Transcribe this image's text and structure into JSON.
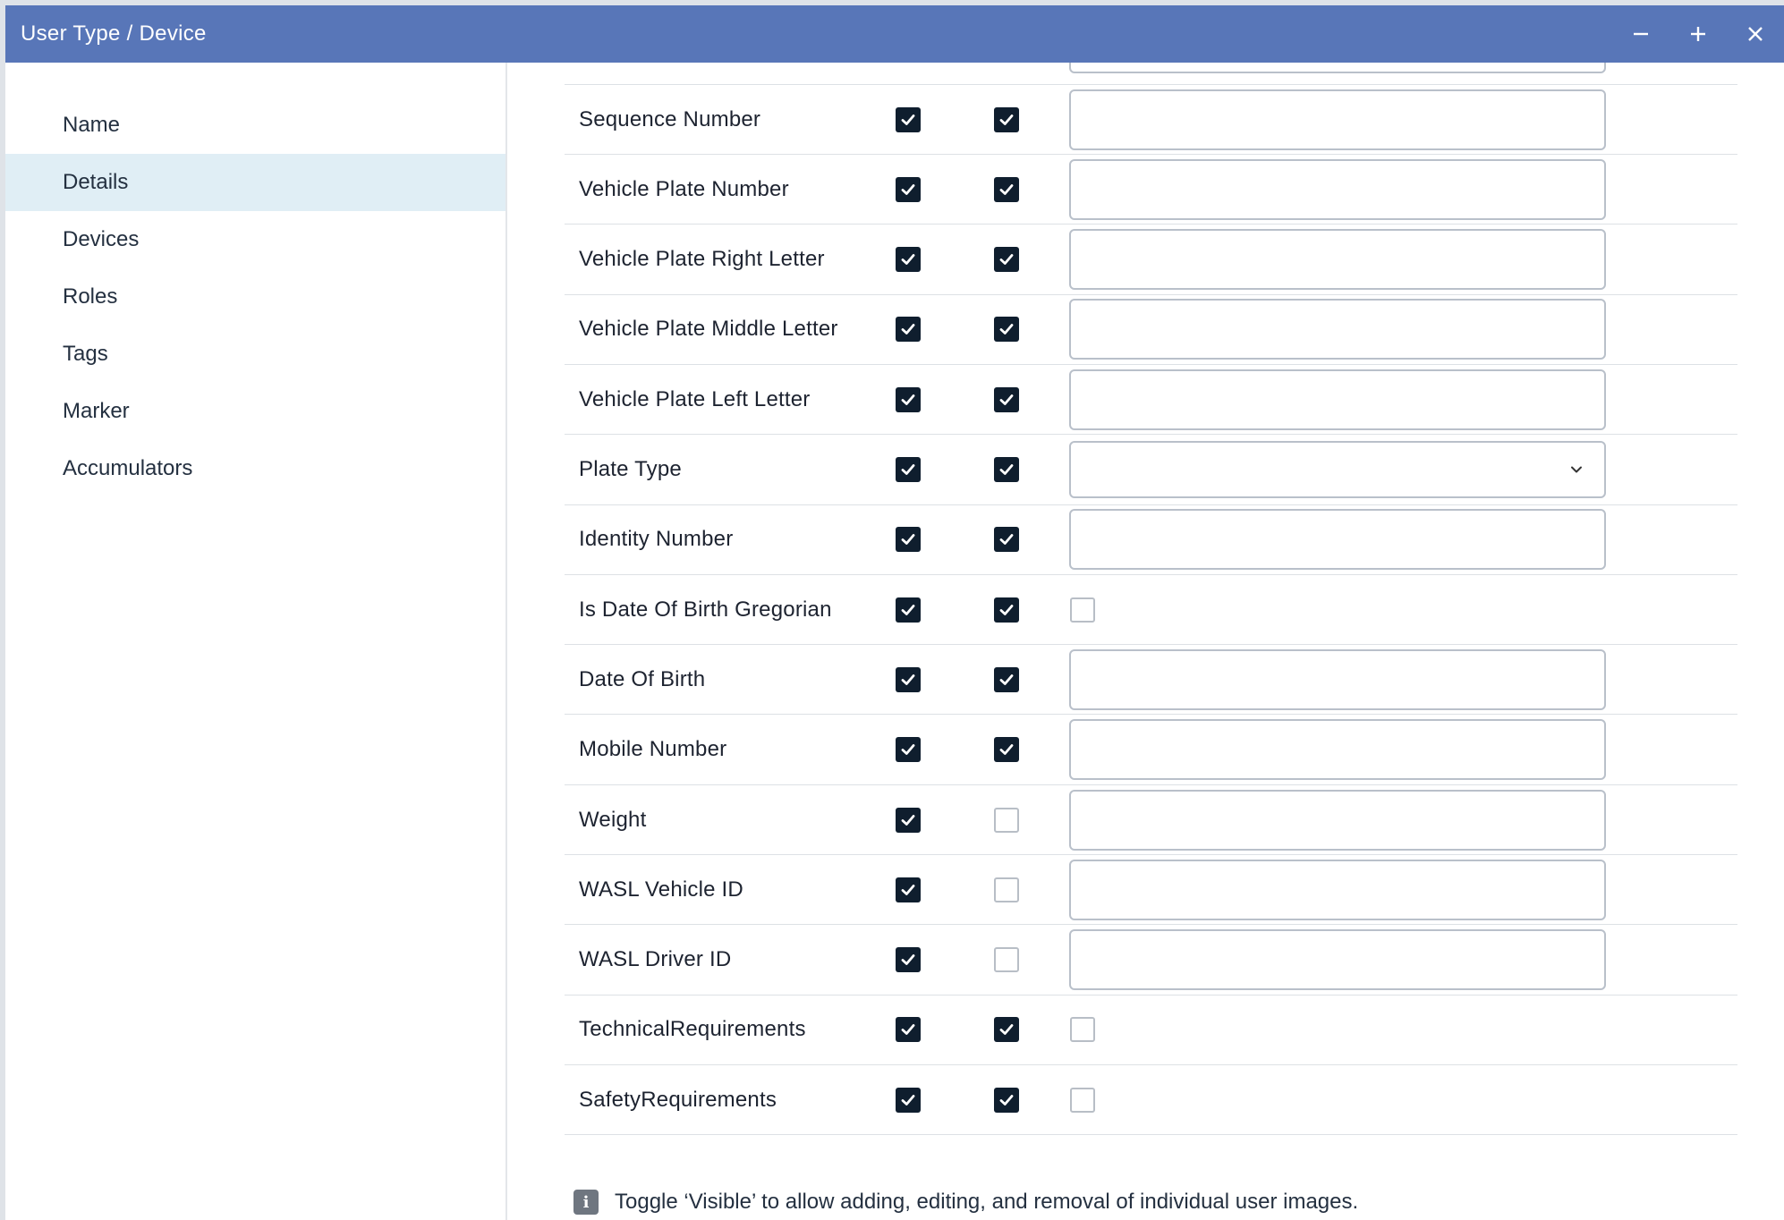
{
  "window": {
    "title": "User Type / Device",
    "minimize_icon": "minus-icon",
    "maximize_icon": "plus-icon",
    "close_icon": "close-icon"
  },
  "sidebar": {
    "items": [
      {
        "label": "Name",
        "active": false
      },
      {
        "label": "Details",
        "active": true
      },
      {
        "label": "Devices",
        "active": false
      },
      {
        "label": "Roles",
        "active": false
      },
      {
        "label": "Tags",
        "active": false
      },
      {
        "label": "Marker",
        "active": false
      },
      {
        "label": "Accumulators",
        "active": false
      }
    ]
  },
  "fields": [
    {
      "label": "Sequence Number",
      "col1": true,
      "col2": true,
      "control": "text",
      "value": ""
    },
    {
      "label": "Vehicle Plate Number",
      "col1": true,
      "col2": true,
      "control": "text",
      "value": ""
    },
    {
      "label": "Vehicle Plate Right Letter",
      "col1": true,
      "col2": true,
      "control": "text",
      "value": ""
    },
    {
      "label": "Vehicle Plate Middle Letter",
      "col1": true,
      "col2": true,
      "control": "text",
      "value": ""
    },
    {
      "label": "Vehicle Plate Left Letter",
      "col1": true,
      "col2": true,
      "control": "text",
      "value": ""
    },
    {
      "label": "Plate Type",
      "col1": true,
      "col2": true,
      "control": "select",
      "value": ""
    },
    {
      "label": "Identity Number",
      "col1": true,
      "col2": true,
      "control": "text",
      "value": ""
    },
    {
      "label": "Is Date Of Birth Gregorian",
      "col1": true,
      "col2": true,
      "control": "checkbox",
      "value": false
    },
    {
      "label": "Date Of Birth",
      "col1": true,
      "col2": true,
      "control": "text",
      "value": ""
    },
    {
      "label": "Mobile Number",
      "col1": true,
      "col2": true,
      "control": "text",
      "value": ""
    },
    {
      "label": "Weight",
      "col1": true,
      "col2": false,
      "control": "text",
      "value": ""
    },
    {
      "label": "WASL Vehicle ID",
      "col1": true,
      "col2": false,
      "control": "text",
      "value": ""
    },
    {
      "label": "WASL Driver ID",
      "col1": true,
      "col2": false,
      "control": "text",
      "value": ""
    },
    {
      "label": "TechnicalRequirements",
      "col1": true,
      "col2": true,
      "control": "checkbox",
      "value": false
    },
    {
      "label": "SafetyRequirements",
      "col1": true,
      "col2": true,
      "control": "checkbox",
      "value": false
    }
  ],
  "info": {
    "icon": "info-icon",
    "text": "Toggle ‘Visible’ to allow adding, editing, and removal of individual user images."
  },
  "colors": {
    "titlebar": "#5876b8",
    "active_nav": "#e0eef5",
    "checkbox_on": "#0f1e2e"
  }
}
